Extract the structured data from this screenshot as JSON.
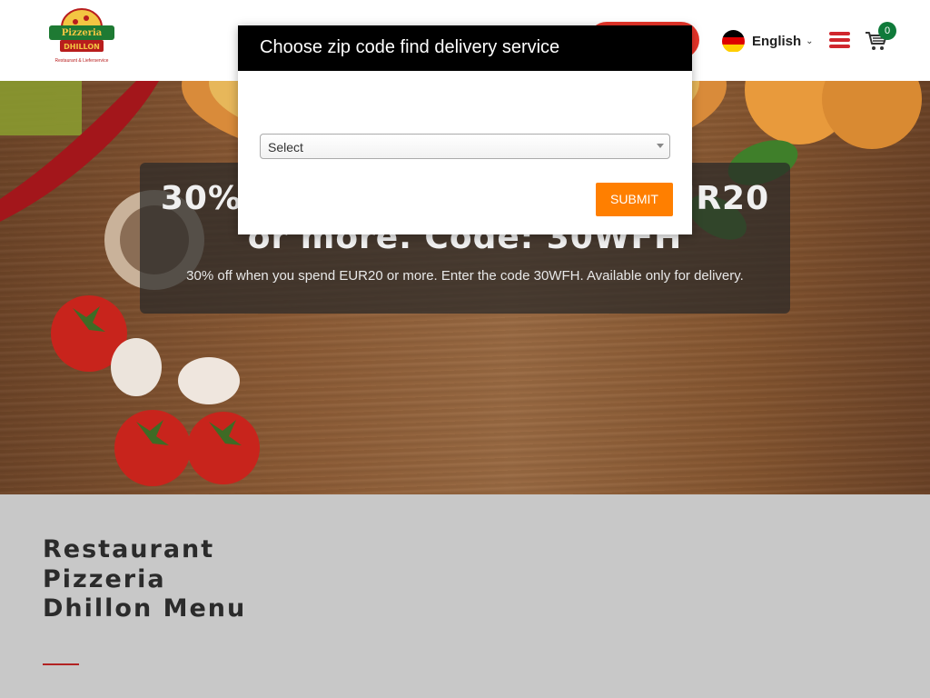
{
  "header": {
    "logo_name": "Pizzeria",
    "logo_subname": "DHILLON",
    "logo_tagline": "Restaurant & Lieferservice",
    "language": "English",
    "language_flag": "germany-flag-icon",
    "cart_count": "0",
    "accent_color": "#d0262d"
  },
  "hero": {
    "promo_title": "30% off when you spend EUR20 or more. Code: 30WFH",
    "promo_text": "30% off when you spend EUR20 or more. Enter the code 30WFH. Available only for delivery."
  },
  "menu_section": {
    "title": "Restaurant Pizzeria Dhillon Menu"
  },
  "modal": {
    "title": "Choose zip code find delivery service",
    "select_value": "Select",
    "submit_label": "SUBMIT",
    "button_color": "#ff7f00"
  }
}
